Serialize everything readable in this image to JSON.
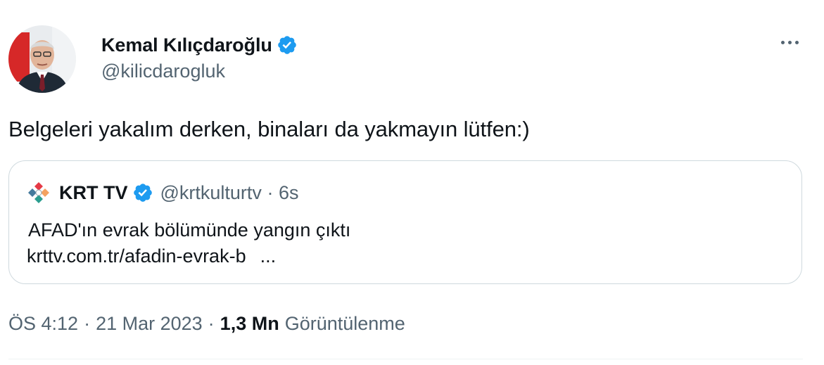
{
  "author": {
    "name": "Kemal Kılıçdaroğlu",
    "handle": "@kilicdarogluk",
    "verified": true
  },
  "tweet": {
    "text": "Belgeleri yakalım derken, binaları da yakmayın lütfen:)"
  },
  "quoted": {
    "name": "KRT TV",
    "handle": "@krtkulturtv",
    "age": "6s",
    "headline": "AFAD'ın evrak bölümünde yangın çıktı",
    "link": "krttv.com.tr/afadin-evrak-b",
    "ellipsis": "..."
  },
  "footer": {
    "time": "ÖS 4:12",
    "date": "21 Mar 2023",
    "views": "1,3 Mn",
    "views_label": "Görüntülenme"
  },
  "colors": {
    "verified": "#1d9bf0",
    "secondary": "#536471",
    "border": "#cfd9de"
  }
}
